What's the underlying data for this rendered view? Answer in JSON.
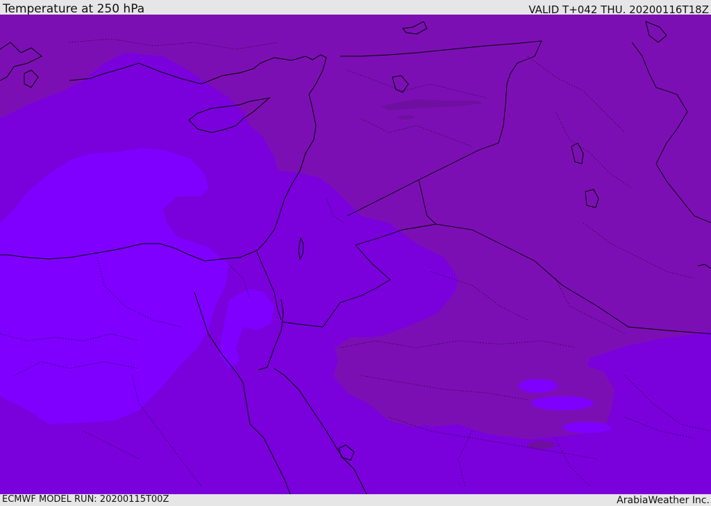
{
  "header": {
    "title": "Temperature at 250 hPa",
    "valid": "VALID T+042 THU. 20200116T18Z"
  },
  "footer": {
    "model_run": "ECMWF MODEL RUN: 20200115T00Z",
    "credit": "ArabiaWeather Inc."
  },
  "map": {
    "field": "temperature",
    "level": "250 hPa",
    "colors": {
      "background": "#7a00dc",
      "colder_zone": "#7c0fb4",
      "warmer_zone": "#7f00ff",
      "cold_core": "#6e0fa0",
      "coastline": "#000000",
      "border": "#000000"
    }
  }
}
